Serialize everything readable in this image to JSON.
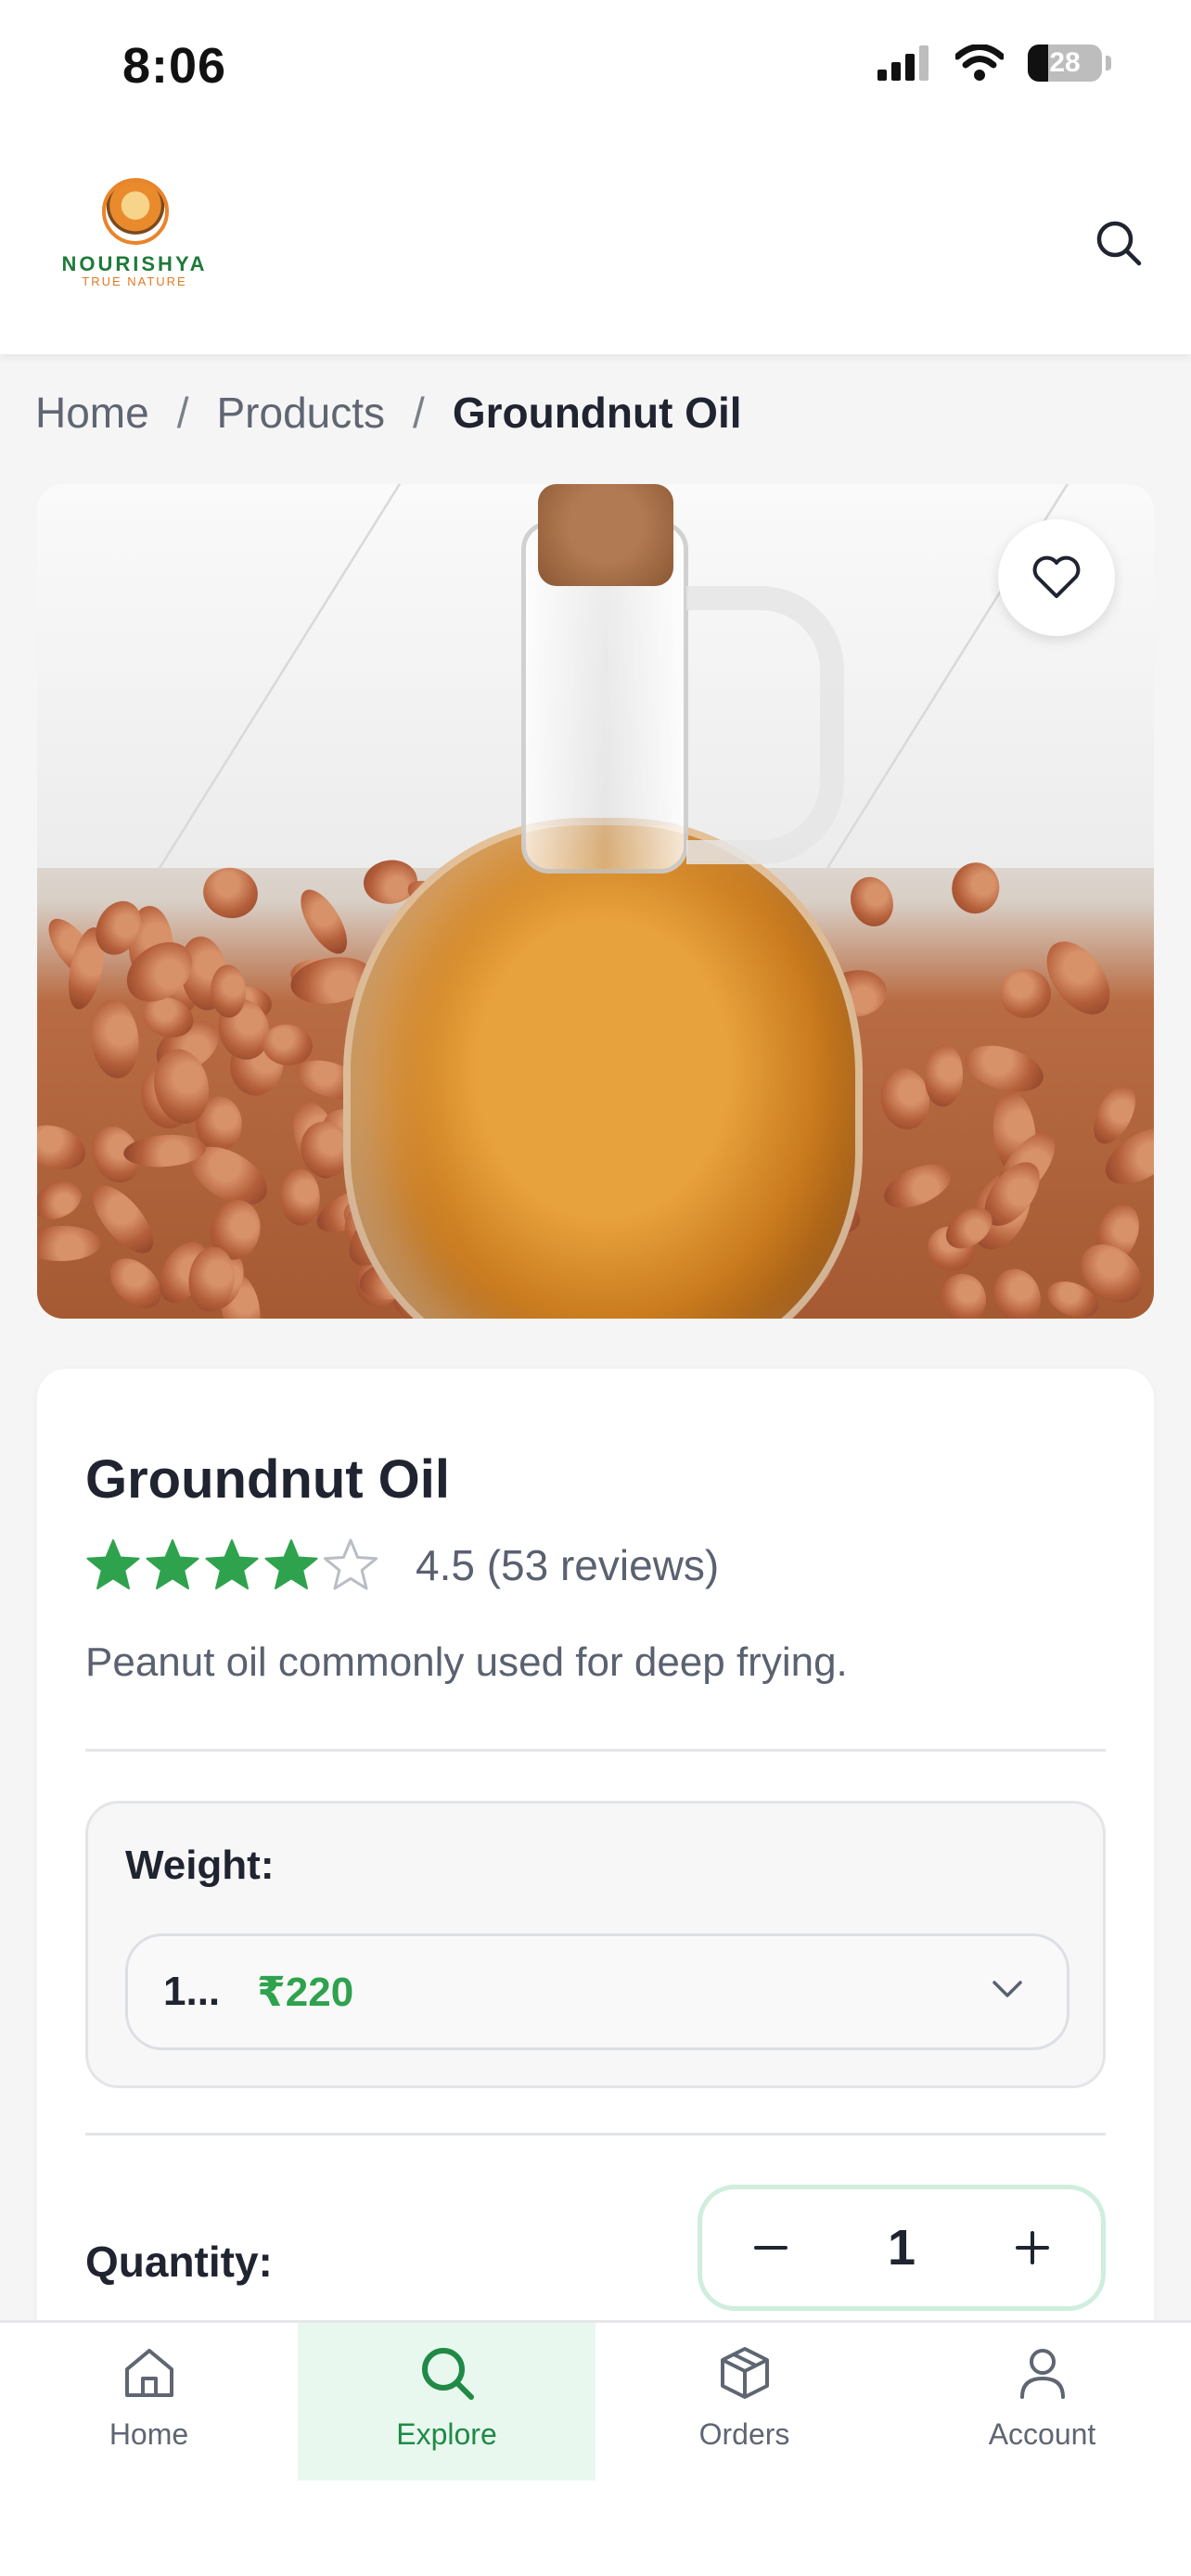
{
  "status_bar": {
    "time": "8:06",
    "battery": "28",
    "battery_level": 0.28
  },
  "header": {
    "brand_name": "NOURISHYA",
    "brand_tagline": "TRUE NATURE",
    "search_icon": "search-icon"
  },
  "breadcrumb": {
    "items": [
      "Home",
      "Products",
      "Groundnut Oil"
    ],
    "separator": "/"
  },
  "product": {
    "title": "Groundnut Oil",
    "rating": 4.5,
    "rating_text": "4.5 (53 reviews)",
    "description": "Peanut oil commonly used for deep frying.",
    "favorite_icon": "heart-icon",
    "weight_label": "Weight:",
    "weight_value": "1...",
    "weight_price": "₹220",
    "quantity_label": "Quantity:",
    "quantity": "1"
  },
  "bottom_nav": {
    "items": [
      {
        "label": "Home",
        "icon": "home-icon",
        "active": false
      },
      {
        "label": "Explore",
        "icon": "search-icon",
        "active": true
      },
      {
        "label": "Orders",
        "icon": "box-icon",
        "active": false
      },
      {
        "label": "Account",
        "icon": "user-icon",
        "active": false
      }
    ]
  },
  "colors": {
    "accent": "#2fa24e",
    "active_bg": "#e8f8ef",
    "star": "#2fa24e"
  }
}
